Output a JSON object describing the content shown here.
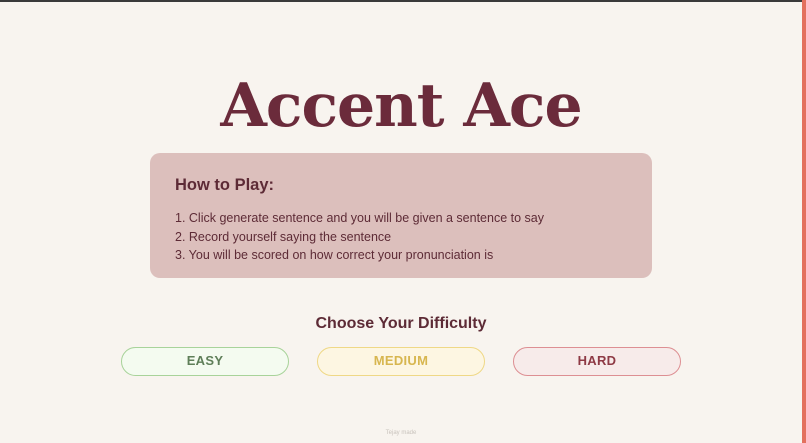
{
  "app": {
    "title": "Accent Ace"
  },
  "how_to_play": {
    "heading": "How to Play:",
    "steps": [
      "1. Click generate sentence and you will be given a sentence to say",
      "2. Record yourself saying the sentence",
      "3. You will be scored on how correct your pronunciation is"
    ]
  },
  "difficulty": {
    "heading": "Choose Your Difficulty",
    "options": [
      {
        "label": "EASY",
        "color": "#a8d39a"
      },
      {
        "label": "MEDIUM",
        "color": "#efd886"
      },
      {
        "label": "HARD",
        "color": "#dd8f93"
      }
    ]
  },
  "footer": {
    "text": "Tejay made"
  },
  "theme": {
    "background": "#f8f4ef",
    "primary_text": "#6b2b3b",
    "card_background": "#dcbfbc",
    "accent_edge": "#e3705e"
  }
}
